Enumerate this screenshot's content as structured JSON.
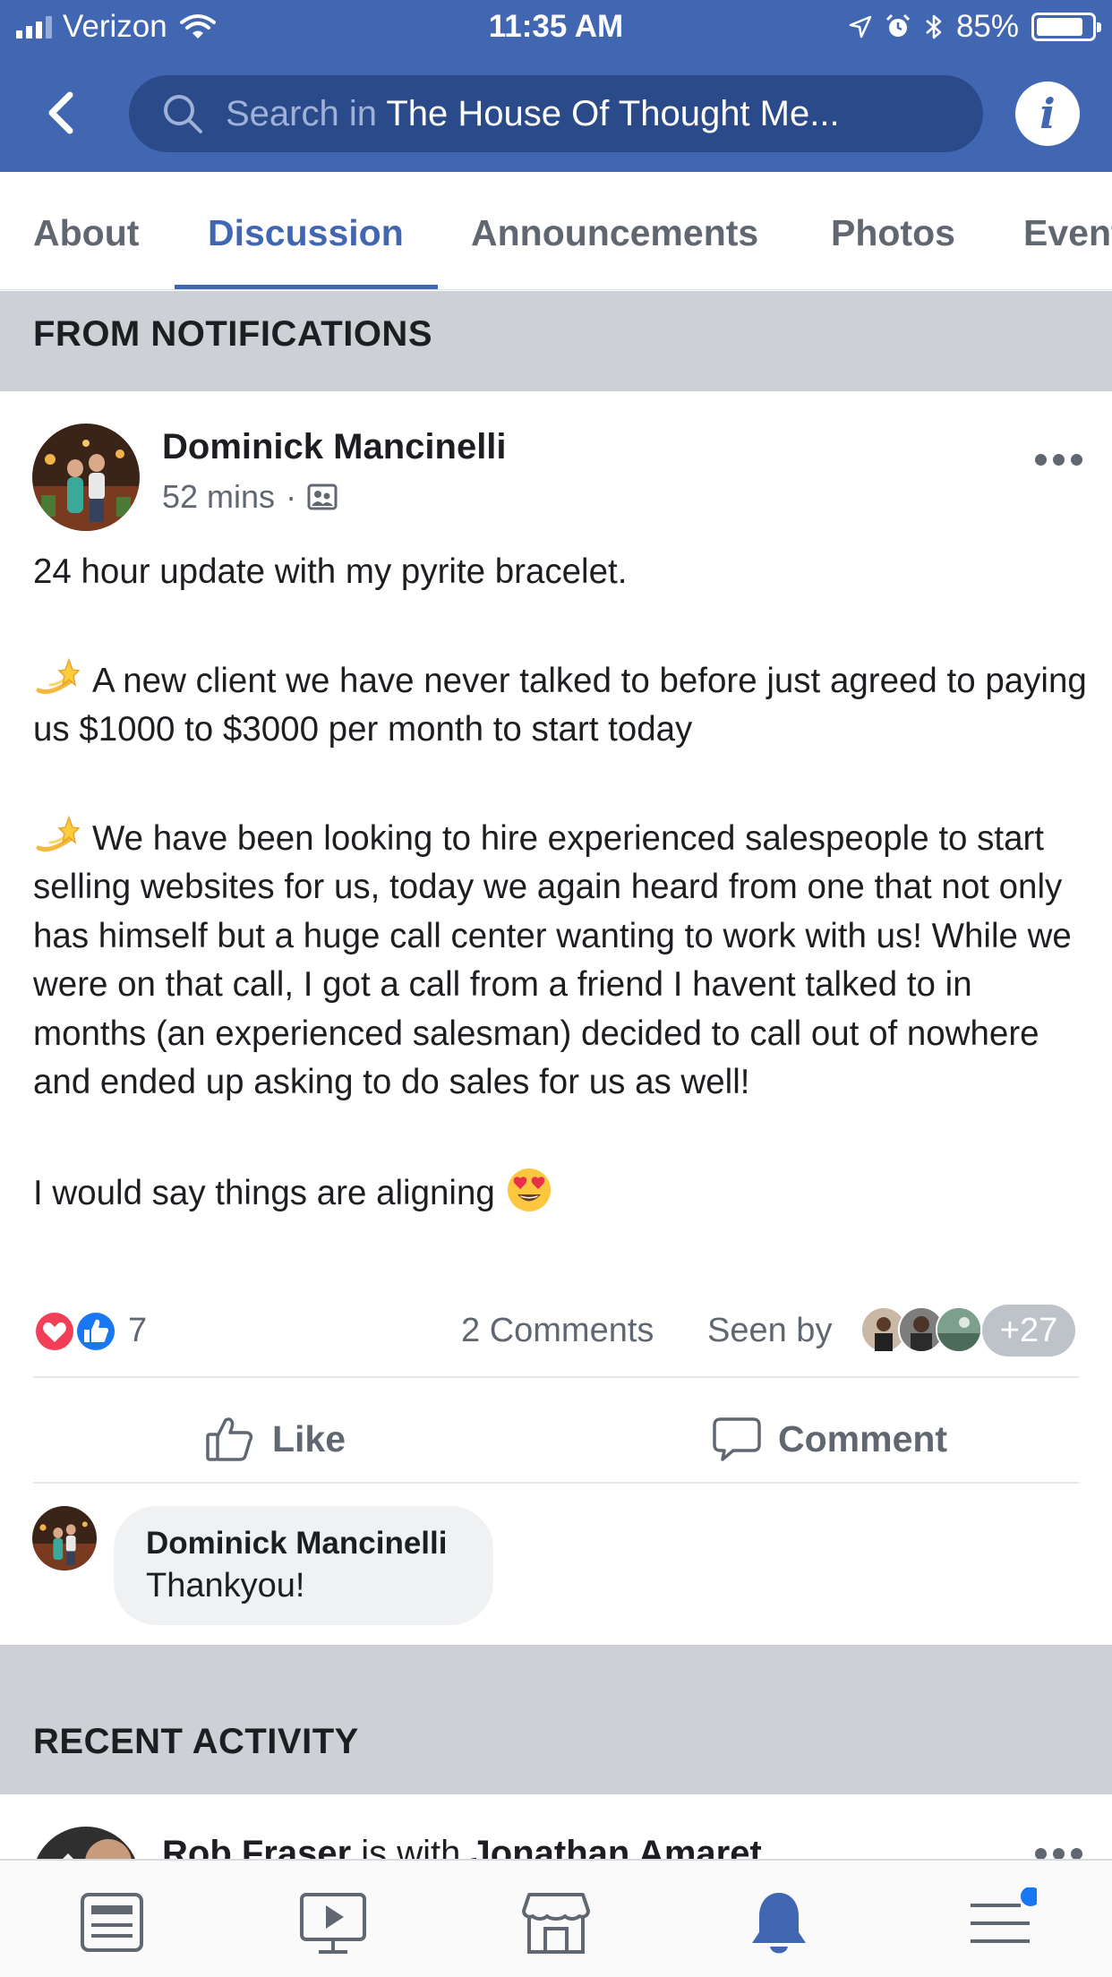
{
  "status_bar": {
    "carrier": "Verizon",
    "time": "11:35 AM",
    "battery": "85%",
    "battery_level": 0.85
  },
  "nav": {
    "search_prefix": "Search in ",
    "search_group": "The House Of Thought Me...",
    "info_glyph": "i"
  },
  "tabs": [
    {
      "label": "About",
      "active": false
    },
    {
      "label": "Discussion",
      "active": true
    },
    {
      "label": "Announcements",
      "active": false
    },
    {
      "label": "Photos",
      "active": false
    },
    {
      "label": "Event",
      "active": false
    }
  ],
  "sections": {
    "from_notifications": "FROM NOTIFICATIONS",
    "recent_activity": "RECENT ACTIVITY"
  },
  "post": {
    "author": "Dominick Mancinelli",
    "time": "52 mins",
    "separator": "·",
    "line1": "24 hour update with my pyrite bracelet.",
    "para2": "A new client we have never talked to before just agreed to paying us $1000 to $3000 per month to start today",
    "para3": "We have been looking to hire experienced salespeople to start selling websites for us, today we again heard from one that not only has himself but a huge call center wanting to work with us!  While we were on that call, I got a call from a friend I havent talked to in months (an experienced salesman)  decided to call out of nowhere and ended up asking to do sales for us as well!",
    "para4": "I would say things are aligning",
    "reaction_count": "7",
    "comments": "2 Comments",
    "seen_by": "Seen by",
    "seen_more": "+27",
    "like_label": "Like",
    "comment_label": "Comment"
  },
  "comment": {
    "author": "Dominick Mancinelli",
    "text": "Thankyou!"
  },
  "recent": {
    "author": "Rob Fraser",
    "with_text": " is with ",
    "tagged": "Jonathan Amaret"
  },
  "colors": {
    "brand": "#4267b2",
    "love": "#f33e58",
    "like": "#1877f2",
    "notification_dot": "#1877f2"
  },
  "bottom_nav": [
    "news-feed-icon",
    "watch-icon",
    "marketplace-icon",
    "notifications-icon",
    "menu-icon"
  ]
}
